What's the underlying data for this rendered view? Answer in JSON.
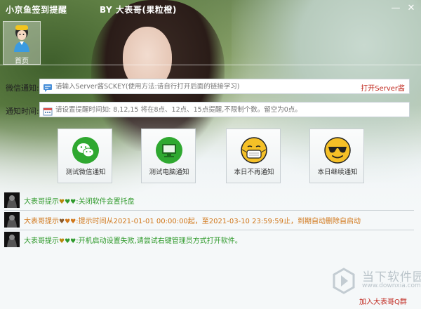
{
  "window": {
    "app_title": "小京鱼签到提醒",
    "author_title": "BY 大表哥(果粒橙)"
  },
  "controls": {
    "minimize": "—",
    "close": "✕"
  },
  "tabs": [
    {
      "label": "首页"
    }
  ],
  "wechat": {
    "label": "微信通知:",
    "placeholder": "请输入Server酱SCKEY(使用方法:请自行打开后面的链接学习)",
    "link": "打开Server酱"
  },
  "time": {
    "label": "通知时间:",
    "placeholder": "请设置提醒时间如: 8,12,15 将在8点、12点、15点提醒,不限制个数。留空为0点。"
  },
  "actions": [
    {
      "label": "测试微信通知",
      "icon": "wechat-icon",
      "color": "#2fa830"
    },
    {
      "label": "测试电脑通知",
      "icon": "computer-icon",
      "color": "#2fa830"
    },
    {
      "label": "本日不再通知",
      "icon": "mask-emoji-icon",
      "color": "#f5c027"
    },
    {
      "label": "本日继续通知",
      "icon": "sunglasses-emoji-icon",
      "color": "#f5c027"
    }
  ],
  "logs": [
    {
      "prefix": "大表哥提示",
      "hearts": "♥♥♥",
      "colon": ":",
      "text": "关闭软件会置托盘",
      "tone": "green"
    },
    {
      "prefix": "大表哥提示",
      "hearts": "♥♥♥",
      "colon": ":",
      "text": "提示时间从2021-01-01 00:00:00起，至2021-03-10 23:59:59止，到期自动删除自启动",
      "tone": "orange"
    },
    {
      "prefix": "大表哥提示",
      "hearts": "♥♥♥",
      "colon": ":",
      "text": "开机启动设置失败,请尝试右键管理员方式打开软件。",
      "tone": "green"
    }
  ],
  "footer": {
    "brand_name": "当下软件园",
    "brand_url": "www.downxia.com",
    "qq_link": "加入大表哥Q群"
  },
  "colors": {
    "green": "#2f9a2b",
    "orange": "#d1771a",
    "link_red": "#c0281e"
  }
}
